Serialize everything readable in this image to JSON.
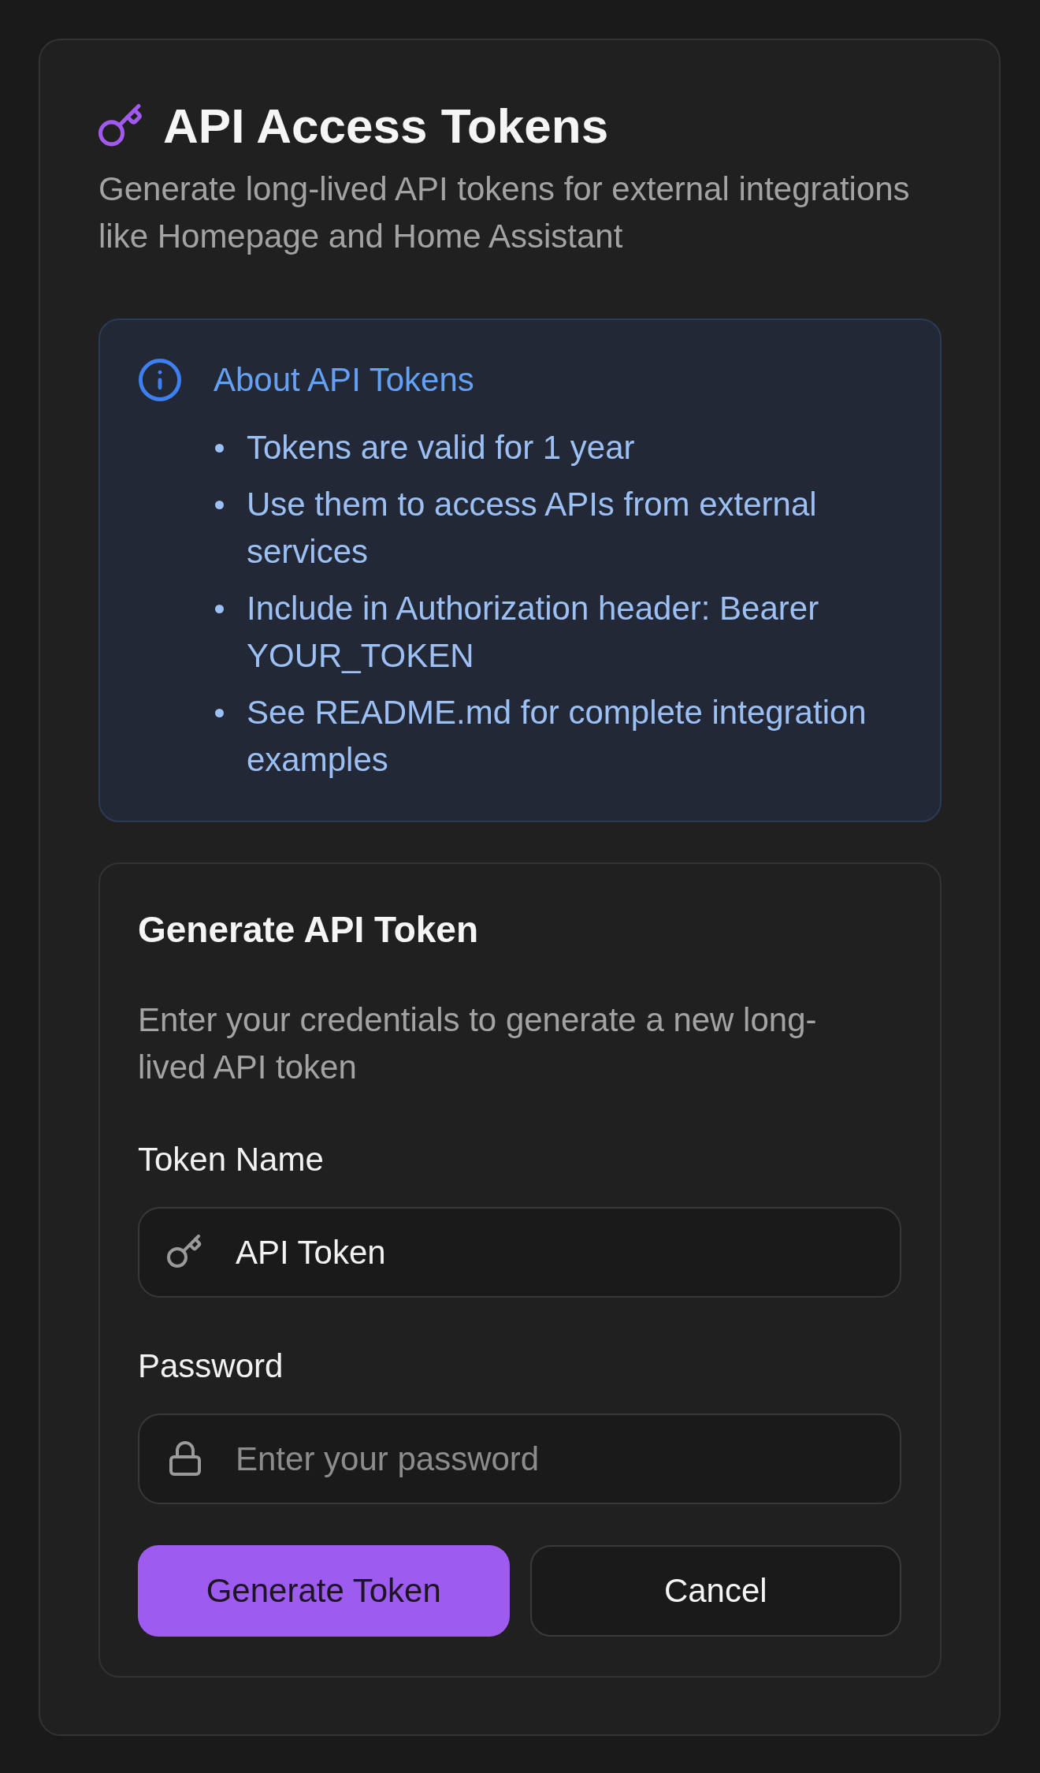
{
  "header": {
    "title": "API Access Tokens",
    "subtitle": "Generate long-lived API tokens for external integrations like Homepage and Home Assistant"
  },
  "info_box": {
    "title": "About API Tokens",
    "items": [
      "Tokens are valid for 1 year",
      "Use them to access APIs from external services",
      "Include in Authorization header: Bearer YOUR_TOKEN",
      "See README.md for complete integration examples"
    ]
  },
  "form": {
    "title": "Generate API Token",
    "description": "Enter your credentials to generate a new long-lived API token",
    "fields": [
      {
        "kind": "text",
        "label": "Token Name",
        "value": "API Token"
      },
      {
        "kind": "password",
        "label": "Password",
        "placeholder": "Enter your password"
      }
    ],
    "buttons": [
      {
        "kind": "primary",
        "label": "Generate Token"
      },
      {
        "kind": "secondary",
        "label": "Cancel"
      }
    ]
  }
}
